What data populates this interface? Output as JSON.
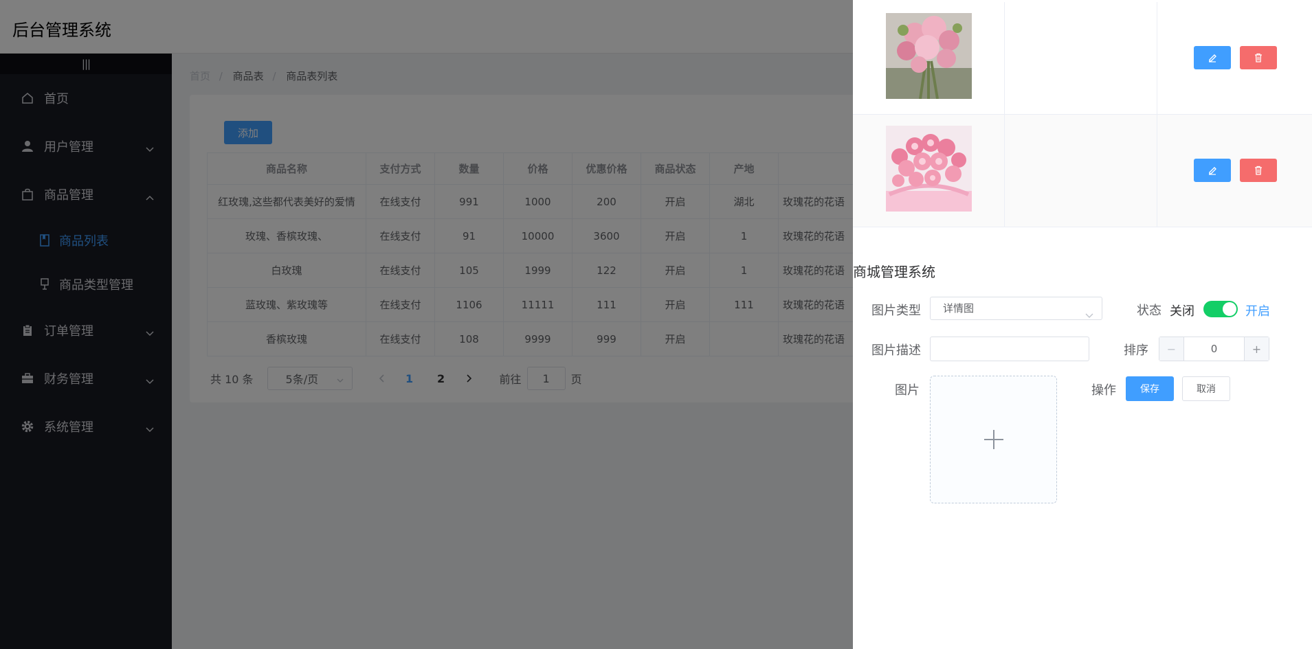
{
  "header": {
    "app_title": "后台管理系统"
  },
  "sidebar": {
    "collapse_label": "|||",
    "items": [
      {
        "label": "首页",
        "icon": "home-icon"
      },
      {
        "label": "用户管理",
        "icon": "user-icon"
      },
      {
        "label": "商品管理",
        "icon": "bag-icon"
      },
      {
        "label": "订单管理",
        "icon": "clipboard-icon"
      },
      {
        "label": "财务管理",
        "icon": "briefcase-icon"
      },
      {
        "label": "系统管理",
        "icon": "gear-icon"
      }
    ],
    "subitems": [
      {
        "label": "商品列表",
        "icon": "book-icon",
        "active": true
      },
      {
        "label": "商品类型管理",
        "icon": "lamp-icon"
      }
    ]
  },
  "breadcrumb": [
    "首页",
    "商品表",
    "商品表列表"
  ],
  "toolbar": {
    "add_label": "添加"
  },
  "table": {
    "columns": [
      "商品名称",
      "支付方式",
      "数量",
      "价格",
      "优惠价格",
      "商品状态",
      "产地",
      ""
    ],
    "rows": [
      [
        "红玫瑰,这些都代表美好的爱情",
        "在线支付",
        "991",
        "1000",
        "200",
        "开启",
        "湖北",
        "玫瑰花的花语"
      ],
      [
        "玫瑰、香槟玫瑰、",
        "在线支付",
        "91",
        "10000",
        "3600",
        "开启",
        "1",
        "玫瑰花的花语"
      ],
      [
        "白玫瑰",
        "在线支付",
        "105",
        "1999",
        "122",
        "开启",
        "1",
        "玫瑰花的花语"
      ],
      [
        "蓝玫瑰、紫玫瑰等",
        "在线支付",
        "1106",
        "11111",
        "111",
        "开启",
        "111",
        "玫瑰花的花语"
      ],
      [
        "香槟玫瑰",
        "在线支付",
        "108",
        "9999",
        "999",
        "开启",
        "",
        "玫瑰花的花语"
      ]
    ]
  },
  "pagination": {
    "total_text": "共 10 条",
    "page_size": "5条/页",
    "pages": [
      "1",
      "2"
    ],
    "current": "1",
    "goto_prefix": "前往",
    "goto_value": "1",
    "goto_suffix": "页"
  },
  "drawer": {
    "form_title": "商城管理系统",
    "image_type_label": "图片类型",
    "image_type_value": "详情图",
    "status_label": "状态",
    "status_off": "关闭",
    "status_on": "开启",
    "status_value": true,
    "desc_label": "图片描述",
    "desc_value": "",
    "sort_label": "排序",
    "sort_value": "0",
    "image_label": "图片",
    "action_label": "操作",
    "save_label": "保存",
    "cancel_label": "取消",
    "stepper_minus": "−",
    "stepper_plus": "+"
  },
  "colors": {
    "accent": "#409eff",
    "danger": "#f56c6c",
    "switch_on": "#13ce66",
    "sidebar_bg": "#191a23"
  }
}
